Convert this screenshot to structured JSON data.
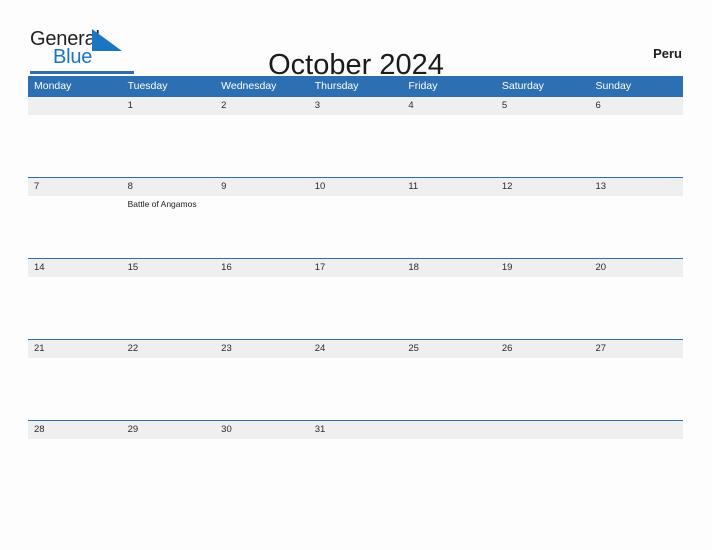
{
  "brand": {
    "name_part1": "General",
    "name_part2": "Blue",
    "flag_icon": "flag-triangle-icon",
    "accent_color": "#2d6fb3"
  },
  "header": {
    "title": "October 2024",
    "country": "Peru"
  },
  "colors": {
    "header_blue": "#2d6fb3",
    "date_band_gray": "#efefef",
    "page_background": "#fdfdfd",
    "text_dark": "#1c1c1c",
    "logo_blue": "#1a76c2"
  },
  "calendar": {
    "month": "October",
    "year": "2024",
    "weekday_headers": [
      "Monday",
      "Tuesday",
      "Wednesday",
      "Thursday",
      "Friday",
      "Saturday",
      "Sunday"
    ],
    "weeks": [
      {
        "days": [
          {
            "date": "",
            "events": []
          },
          {
            "date": "1",
            "events": []
          },
          {
            "date": "2",
            "events": []
          },
          {
            "date": "3",
            "events": []
          },
          {
            "date": "4",
            "events": []
          },
          {
            "date": "5",
            "events": []
          },
          {
            "date": "6",
            "events": []
          }
        ]
      },
      {
        "days": [
          {
            "date": "7",
            "events": []
          },
          {
            "date": "8",
            "events": [
              "Battle of Angamos"
            ]
          },
          {
            "date": "9",
            "events": []
          },
          {
            "date": "10",
            "events": []
          },
          {
            "date": "11",
            "events": []
          },
          {
            "date": "12",
            "events": []
          },
          {
            "date": "13",
            "events": []
          }
        ]
      },
      {
        "days": [
          {
            "date": "14",
            "events": []
          },
          {
            "date": "15",
            "events": []
          },
          {
            "date": "16",
            "events": []
          },
          {
            "date": "17",
            "events": []
          },
          {
            "date": "18",
            "events": []
          },
          {
            "date": "19",
            "events": []
          },
          {
            "date": "20",
            "events": []
          }
        ]
      },
      {
        "days": [
          {
            "date": "21",
            "events": []
          },
          {
            "date": "22",
            "events": []
          },
          {
            "date": "23",
            "events": []
          },
          {
            "date": "24",
            "events": []
          },
          {
            "date": "25",
            "events": []
          },
          {
            "date": "26",
            "events": []
          },
          {
            "date": "27",
            "events": []
          }
        ]
      },
      {
        "days": [
          {
            "date": "28",
            "events": []
          },
          {
            "date": "29",
            "events": []
          },
          {
            "date": "30",
            "events": []
          },
          {
            "date": "31",
            "events": []
          },
          {
            "date": "",
            "events": []
          },
          {
            "date": "",
            "events": []
          },
          {
            "date": "",
            "events": []
          }
        ]
      }
    ]
  }
}
